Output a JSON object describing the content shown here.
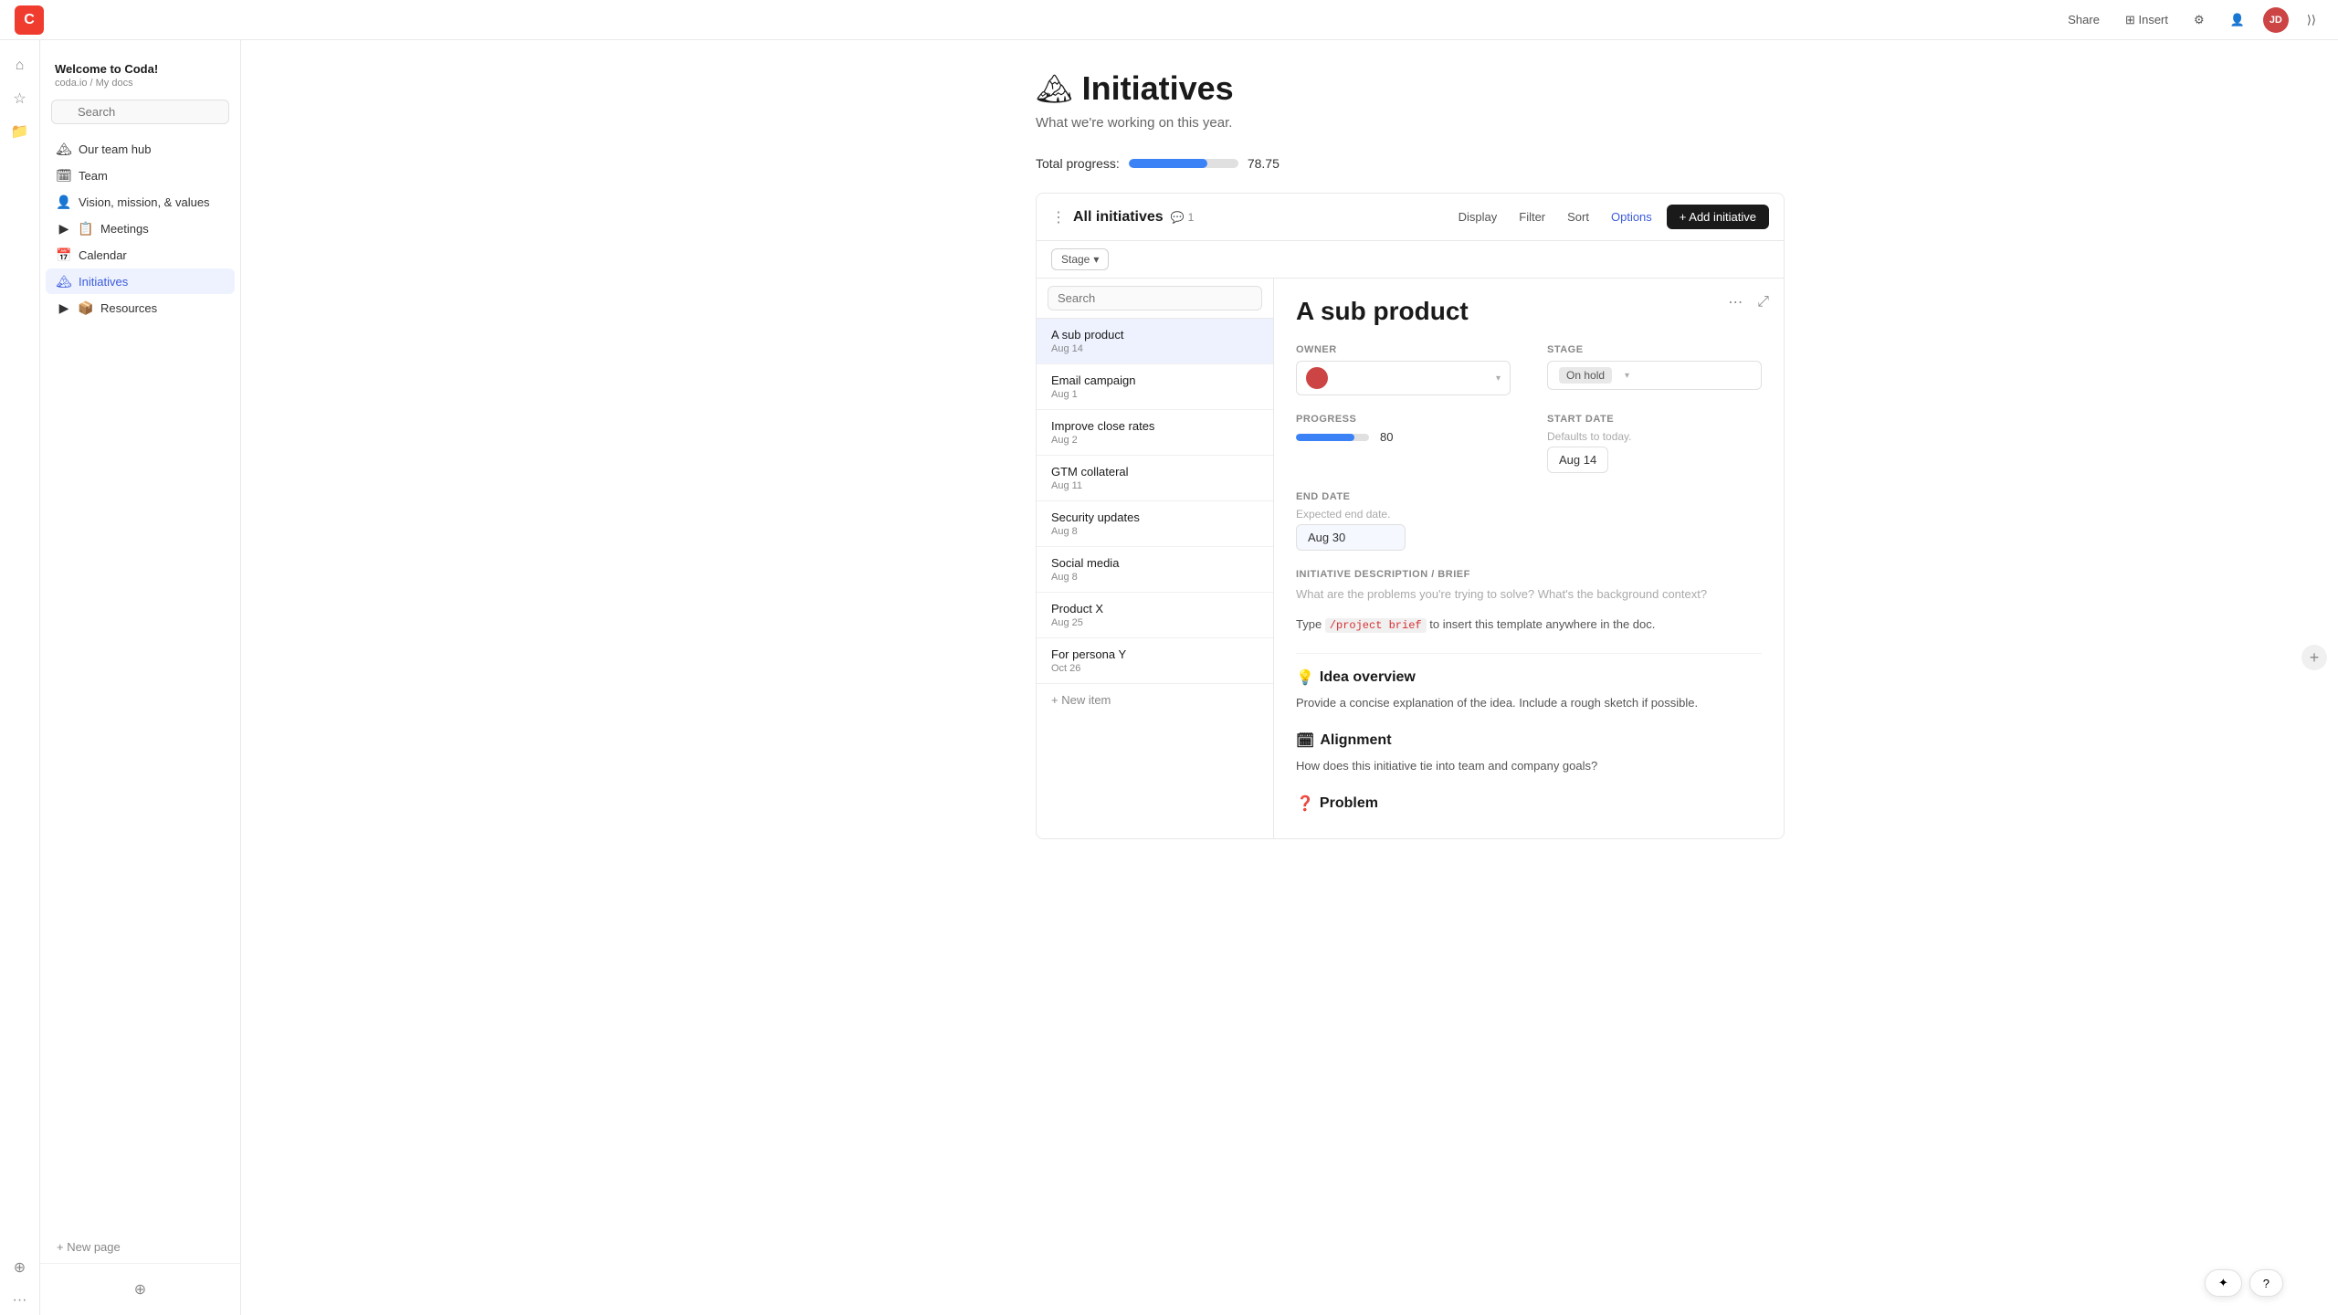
{
  "app": {
    "logo_text": "C",
    "doc_title": "Welcome to Coda!",
    "doc_path": "coda.io / My docs"
  },
  "topbar": {
    "share_label": "Share",
    "insert_label": "⊞ Insert",
    "settings_icon": "⚙",
    "account_icon": "👤",
    "avatar_text": "JD",
    "collapse_icon": "⟩⟩"
  },
  "sidebar_icons": [
    {
      "name": "home-icon",
      "glyph": "⌂"
    },
    {
      "name": "star-icon",
      "glyph": "☆"
    },
    {
      "name": "folder-icon",
      "glyph": "📁"
    }
  ],
  "sidebar": {
    "search_placeholder": "Search",
    "nav_items": [
      {
        "name": "our-team-hub",
        "label": "Our team hub",
        "icon": "🏔",
        "active": false,
        "indent": 0
      },
      {
        "name": "team",
        "label": "Team",
        "icon": "🗓",
        "active": false,
        "indent": 0
      },
      {
        "name": "vision-mission-values",
        "label": "Vision, mission, & values",
        "icon": "👤",
        "active": false,
        "indent": 0
      },
      {
        "name": "meetings",
        "label": "Meetings",
        "icon": "📋",
        "active": false,
        "indent": 0,
        "has_arrow": true
      },
      {
        "name": "calendar",
        "label": "Calendar",
        "icon": "📅",
        "active": false,
        "indent": 0
      },
      {
        "name": "initiatives",
        "label": "Initiatives",
        "icon": "🏔",
        "active": true,
        "indent": 0
      },
      {
        "name": "resources",
        "label": "Resources",
        "icon": "📦",
        "active": false,
        "indent": 0,
        "has_arrow": true
      }
    ],
    "new_page_label": "+ New page",
    "bottom_icon": "⊕"
  },
  "page": {
    "emoji": "🏔",
    "title": "Initiatives",
    "subtitle": "What we're working on this year."
  },
  "progress": {
    "label": "Total progress:",
    "value": "78.75",
    "fill_percent": 72
  },
  "initiatives_section": {
    "title": "All initiatives",
    "comment_count": "1",
    "actions": {
      "display": "Display",
      "filter": "Filter",
      "sort": "Sort",
      "options": "Options"
    },
    "add_button": "+ Add initiative",
    "stage_filter": "Stage",
    "stage_filter_arrow": "▾",
    "list_search_placeholder": "Search",
    "more_icon": "⋯",
    "expand_icon": "⤢"
  },
  "list_items": [
    {
      "name": "A sub product",
      "date": "Aug 14",
      "selected": true
    },
    {
      "name": "Email campaign",
      "date": "Aug 1",
      "selected": false
    },
    {
      "name": "Improve close rates",
      "date": "Aug 2",
      "selected": false
    },
    {
      "name": "GTM collateral",
      "date": "Aug 11",
      "selected": false
    },
    {
      "name": "Security updates",
      "date": "Aug 8",
      "selected": false
    },
    {
      "name": "Social media",
      "date": "Aug 8",
      "selected": false
    },
    {
      "name": "Product X",
      "date": "Aug 25",
      "selected": false
    },
    {
      "name": "For persona Y",
      "date": "Oct 26",
      "selected": false
    }
  ],
  "list_add_item": "+ New item",
  "detail": {
    "title": "A sub product",
    "owner_label": "OWNER",
    "stage_label": "STAGE",
    "stage_value": "On hold",
    "progress_label": "PROGRESS",
    "progress_value": "80",
    "progress_fill": 80,
    "start_date_label": "START DATE",
    "start_date_hint": "Defaults to today.",
    "start_date_value": "Aug 14",
    "end_date_label": "END DATE",
    "end_date_hint": "Expected end date.",
    "end_date_value": "Aug 30",
    "description_label": "INITIATIVE DESCRIPTION / BRIEF",
    "description_placeholder": "What are the problems you're trying to solve? What's the background context?",
    "code_text_before": "Type ",
    "code_snippet": "/project brief",
    "code_text_after": " to insert this template anywhere in the doc.",
    "idea_overview_emoji": "💡",
    "idea_overview_heading": "Idea overview",
    "idea_overview_text": "Provide a concise explanation of the idea. Include a rough sketch if possible.",
    "alignment_emoji": "🗓",
    "alignment_heading": "Alignment",
    "alignment_text": "How does this initiative tie into team and company goals?",
    "problem_emoji": "❓",
    "problem_heading": "Problem"
  },
  "bottom_toolbar": {
    "sparkle_btn": "✦",
    "help_btn": "?"
  }
}
